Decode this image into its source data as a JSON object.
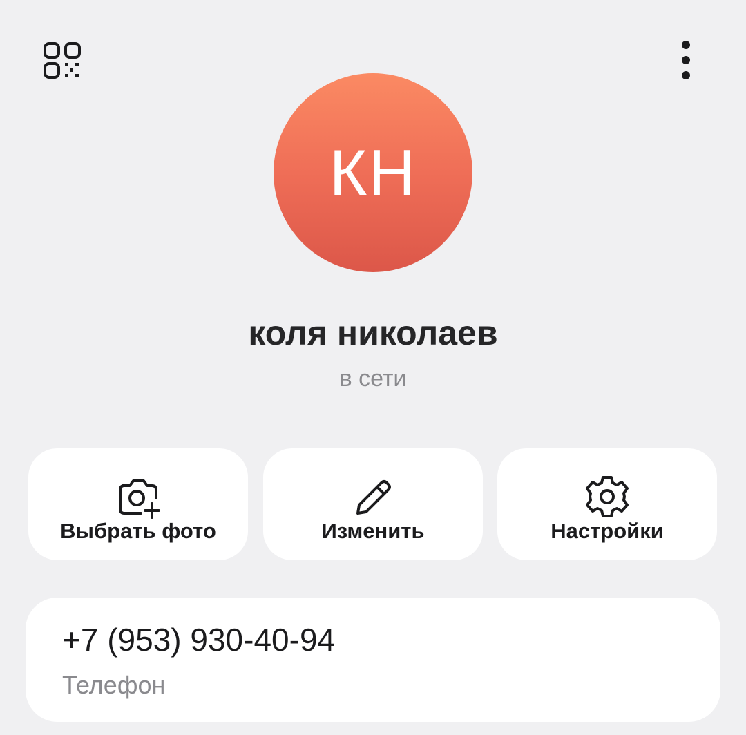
{
  "header": {
    "left_icon": "qr-code-icon",
    "right_icon": "more-vertical-icon"
  },
  "profile": {
    "initials": "КН",
    "avatar_gradient": [
      "#fb8a63",
      "#dc5749"
    ],
    "name": "коля николаев",
    "status": "в сети"
  },
  "actions": [
    {
      "label": "Выбрать фото",
      "icon": "add-photo-camera-icon"
    },
    {
      "label": "Изменить",
      "icon": "pencil-icon"
    },
    {
      "label": "Настройки",
      "icon": "gear-icon"
    }
  ],
  "info": {
    "phone": "+7 (953) 930-40-94",
    "phone_label": "Телефон"
  },
  "colors": {
    "background": "#f0f0f2",
    "card": "#ffffff",
    "secondary_text": "#8a8a8e"
  }
}
